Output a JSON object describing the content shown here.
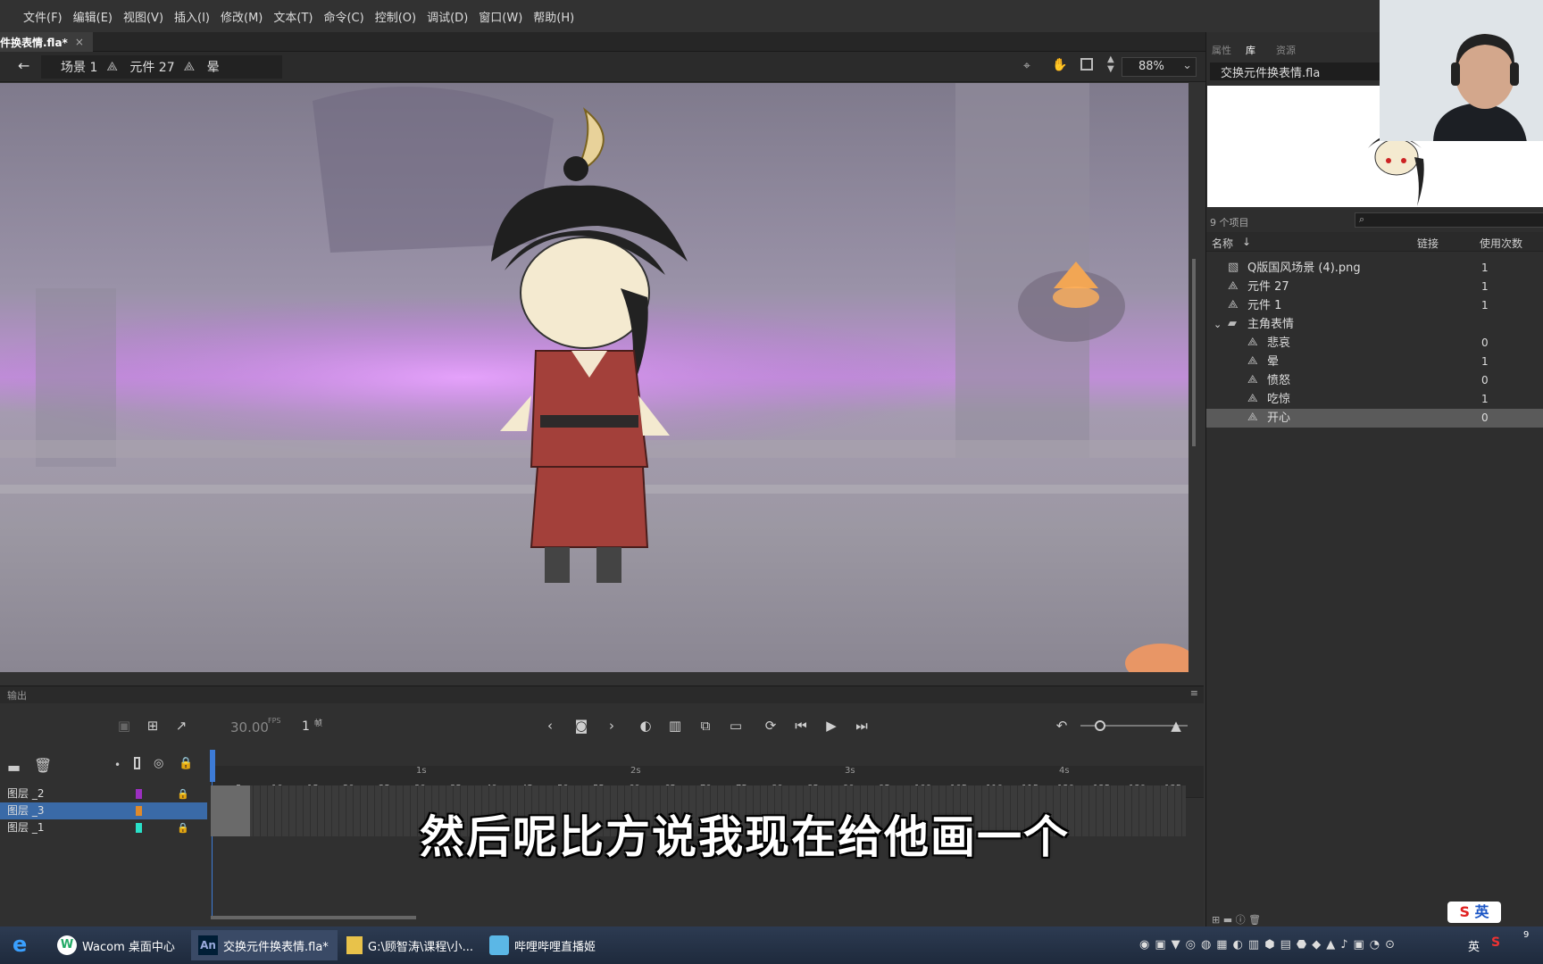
{
  "menubar": {
    "items": [
      "文件(F)",
      "编辑(E)",
      "视图(V)",
      "插入(I)",
      "修改(M)",
      "文本(T)",
      "命令(C)",
      "控制(O)",
      "调试(D)",
      "窗口(W)",
      "帮助(H)"
    ]
  },
  "doc_tab": {
    "title": "件换表情.fla*",
    "close": "×"
  },
  "editbar": {
    "back": "←",
    "scene": "场景 1",
    "symbol1": "元件 27",
    "symbol2": "晕",
    "zoom": "88%"
  },
  "output": {
    "title": "输出"
  },
  "timeline": {
    "fps": "30.00",
    "fps_unit": "FPS",
    "frame": "1",
    "frame_unit": "帧",
    "seconds": [
      "1s",
      "2s",
      "3s",
      "4s"
    ],
    "ticks": [
      "5",
      "10",
      "15",
      "20",
      "25",
      "30",
      "35",
      "40",
      "45",
      "50",
      "55",
      "60",
      "65",
      "70",
      "75",
      "80",
      "85",
      "90",
      "95",
      "100",
      "105",
      "110",
      "115",
      "120",
      "125",
      "130",
      "135"
    ],
    "layers": [
      {
        "name": "图层 _2",
        "color": "#9b2fc0",
        "locked": true
      },
      {
        "name": "图层 _3",
        "color": "#e08a2a",
        "locked": false,
        "selected": true
      },
      {
        "name": "图层 _1",
        "color": "#29e0c8",
        "locked": true
      }
    ]
  },
  "subtitle": "然后呢比方说我现在给他画一个",
  "library": {
    "tabs": [
      "属性",
      "库",
      "资源"
    ],
    "file": "交换元件换表情.fla",
    "count_label": "9 个项目",
    "col_name": "名称",
    "col_link": "链接",
    "col_uses": "使用次数",
    "items": [
      {
        "name": "Q版国风场景 (4).png",
        "uses": "1",
        "icon": "image-icon",
        "indent": 0
      },
      {
        "name": "元件 27",
        "uses": "1",
        "icon": "symbol-icon",
        "indent": 0
      },
      {
        "name": "元件 1",
        "uses": "1",
        "icon": "symbol-icon",
        "indent": 0
      },
      {
        "name": "主角表情",
        "uses": "",
        "icon": "folder-icon",
        "indent": 0
      },
      {
        "name": "悲哀",
        "uses": "0",
        "icon": "symbol-icon",
        "indent": 1
      },
      {
        "name": "晕",
        "uses": "1",
        "icon": "symbol-icon",
        "indent": 1
      },
      {
        "name": "愤怒",
        "uses": "0",
        "icon": "symbol-icon",
        "indent": 1
      },
      {
        "name": "吃惊",
        "uses": "1",
        "icon": "symbol-icon",
        "indent": 1
      },
      {
        "name": "开心",
        "uses": "0",
        "icon": "symbol-icon",
        "indent": 1,
        "selected": true
      }
    ]
  },
  "taskbar": {
    "tasks": [
      "Wacom 桌面中心",
      "交换元件换表情.fla*",
      "G:\\顾智涛\\课程\\小...",
      "哔哩哔哩直播姬"
    ],
    "ime": "英",
    "clock": "9"
  }
}
